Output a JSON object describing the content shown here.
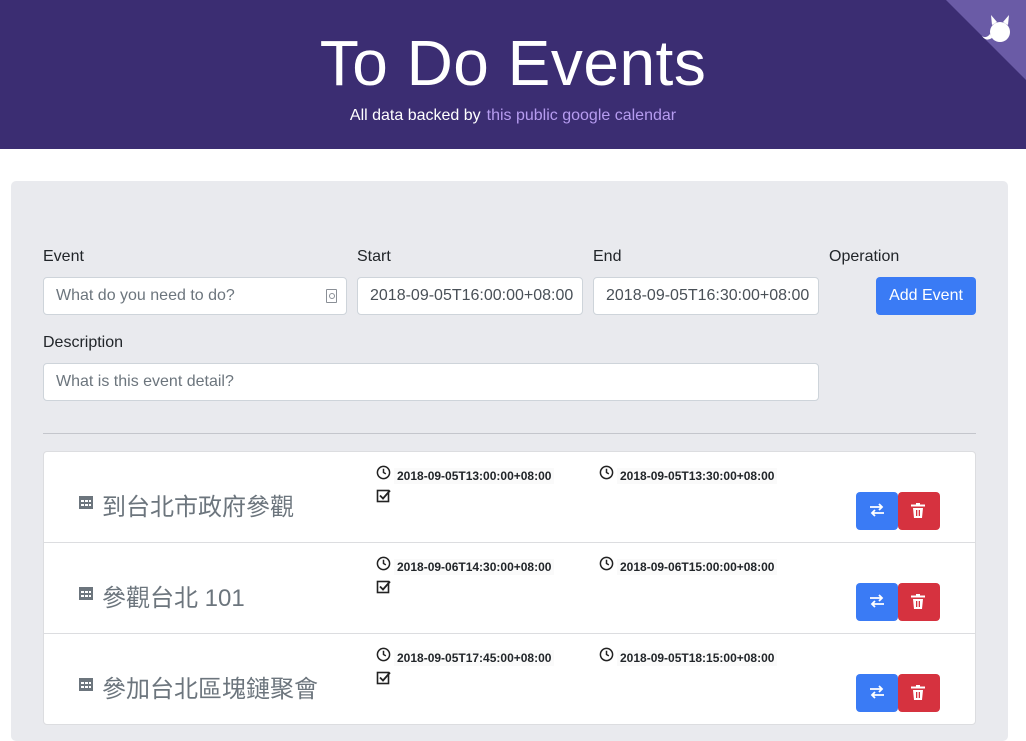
{
  "header": {
    "title": "To Do Events",
    "subtitle_prefix": "All data backed by",
    "subtitle_link": "this public google calendar",
    "corner_icon": "github-octocat-icon"
  },
  "form": {
    "event_label": "Event",
    "event_placeholder": "What do you need to do?",
    "start_label": "Start",
    "start_value": "2018-09-05T16:00:00+08:00",
    "end_label": "End",
    "end_value": "2018-09-05T16:30:00+08:00",
    "operation_label": "Operation",
    "add_button": "Add Event",
    "description_label": "Description",
    "description_placeholder": "What is this event detail?"
  },
  "events": [
    {
      "title": "到台北市政府參觀",
      "start": "2018-09-05T13:00:00+08:00",
      "end": "2018-09-05T13:30:00+08:00"
    },
    {
      "title": "參觀台北 101",
      "start": "2018-09-06T14:30:00+08:00",
      "end": "2018-09-06T15:00:00+08:00"
    },
    {
      "title": "參加台北區塊鏈聚會",
      "start": "2018-09-05T17:45:00+08:00",
      "end": "2018-09-05T18:15:00+08:00"
    }
  ],
  "colors": {
    "header_bg": "#3b2d72",
    "link": "#b69cf0",
    "primary": "#3a7bf5",
    "danger": "#d6323f"
  }
}
